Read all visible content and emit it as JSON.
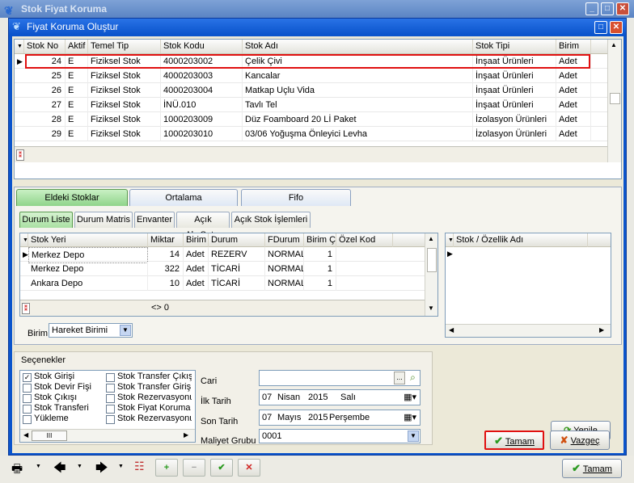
{
  "outer_window": {
    "title": "Stok Fiyat Koruma",
    "min": "_",
    "max": "□",
    "close": "✕"
  },
  "dialog": {
    "title": "Fiyat Koruma Oluştur",
    "max": "□",
    "close": "✕"
  },
  "main_grid": {
    "columns": [
      "Stok No",
      "Aktif",
      "Temel Tip",
      "Stok Kodu",
      "Stok Adı",
      "Stok Tipi",
      "Birim"
    ],
    "rows": [
      [
        "24",
        "E",
        "Fiziksel Stok",
        "4000203002",
        "Çelik Çivi",
        "İnşaat Ürünleri",
        "Adet"
      ],
      [
        "25",
        "E",
        "Fiziksel Stok",
        "4000203003",
        "Kancalar",
        "İnşaat Ürünleri",
        "Adet"
      ],
      [
        "26",
        "E",
        "Fiziksel Stok",
        "4000203004",
        "Matkap Uçlu Vida",
        "İnşaat Ürünleri",
        "Adet"
      ],
      [
        "27",
        "E",
        "Fiziksel Stok",
        "İNÜ.010",
        "Tavlı Tel",
        "İnşaat Ürünleri",
        "Adet"
      ],
      [
        "28",
        "E",
        "Fiziksel Stok",
        "1000203009",
        "Düz Foamboard 20 Lİ Paket",
        "İzolasyon Ürünleri",
        "Adet"
      ],
      [
        "29",
        "E",
        "Fiziksel Stok",
        "1000203010",
        "03/06 Yoğuşma Önleyici Levha",
        "İzolasyon Ürünleri",
        "Adet"
      ]
    ]
  },
  "top_tabs": [
    "Eldeki Stoklar",
    "Ortalama",
    "Fifo"
  ],
  "sub_tabs": [
    "Durum Liste",
    "Durum Matris",
    "Envanter",
    "Açık AlışSatış",
    "Açık Stok İşlemleri"
  ],
  "stock_grid": {
    "columns": [
      "Stok Yeri",
      "Miktar",
      "Birim",
      "Durum",
      "FDurum",
      "Birim Ça",
      "Özel Kod"
    ],
    "rows": [
      [
        "Merkez Depo",
        "14",
        "Adet",
        "REZERV",
        "NORMAL",
        "1",
        ""
      ],
      [
        "Merkez Depo",
        "322",
        "Adet",
        "TİCARİ",
        "NORMAL",
        "1",
        ""
      ],
      [
        "Ankara Depo",
        "10",
        "Adet",
        "TİCARİ",
        "NORMAL",
        "1",
        ""
      ]
    ],
    "footer": "<> 0"
  },
  "birim": {
    "label": "Birim",
    "value": "Hareket Birimi"
  },
  "feature_grid": {
    "column": "Stok / Özellik Adı"
  },
  "options": {
    "title": "Seçenekler",
    "col1": [
      {
        "label": "Stok Girişi",
        "checked": true
      },
      {
        "label": "Stok Devir Fişi",
        "checked": false
      },
      {
        "label": "Stok Çıkışı",
        "checked": false
      },
      {
        "label": "Stok Transferi",
        "checked": false
      },
      {
        "label": "Yükleme",
        "checked": false
      }
    ],
    "col2": [
      {
        "label": "Stok Transfer Çıkış",
        "checked": false
      },
      {
        "label": "Stok Transfer Giriş",
        "checked": false
      },
      {
        "label": "Stok Rezervasyonu",
        "checked": false
      },
      {
        "label": "Stok Fiyat Koruma",
        "checked": false
      },
      {
        "label": "Stok Rezervasyonu",
        "checked": false
      }
    ],
    "scroll_thumb": "III"
  },
  "form": {
    "cari_label": "Cari",
    "cari_value": "",
    "ilk_tarih_label": "İlk Tarih",
    "ilk_tarih": {
      "day": "07",
      "month": "Nisan",
      "year": "2015",
      "weekday": "Salı"
    },
    "son_tarih_label": "Son Tarih",
    "son_tarih": {
      "day": "07",
      "month": "Mayıs",
      "year": "2015",
      "weekday": "Perşembe"
    },
    "maliyet_label": "Maliyet Grubu",
    "maliyet_value": "0001",
    "ellipsis": "..."
  },
  "buttons": {
    "yenile": "Yenile",
    "tamam": "Tamam",
    "vazgec": "Vazgeç",
    "outer_tamam": "Tamam"
  },
  "colors": {
    "dialog_blue": "#0a54cc",
    "selection_red": "#e01010",
    "tab_active_green": "#8fd48a"
  }
}
